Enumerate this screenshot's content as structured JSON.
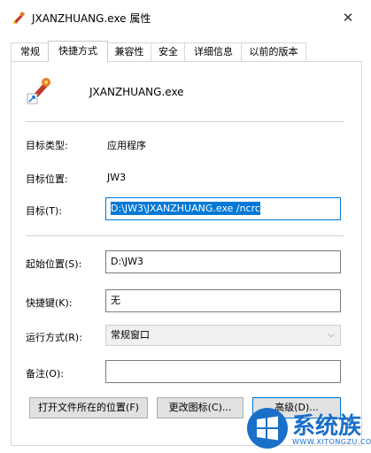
{
  "window": {
    "title": "JXANZHUANG.exe 属性",
    "close_glyph": "✕"
  },
  "tabs": [
    {
      "label": "常规",
      "active": false
    },
    {
      "label": "快捷方式",
      "active": true
    },
    {
      "label": "兼容性",
      "active": false
    },
    {
      "label": "安全",
      "active": false
    },
    {
      "label": "详细信息",
      "active": false
    },
    {
      "label": "以前的版本",
      "active": false
    }
  ],
  "shortcut": {
    "file_name": "JXANZHUANG.exe",
    "target_type_label": "目标类型:",
    "target_type_value": "应用程序",
    "target_location_label": "目标位置:",
    "target_location_value": "JW3",
    "target_label": "目标(T):",
    "target_value": "D:\\JW3\\JXANZHUANG.exe /ncrc",
    "start_in_label": "起始位置(S):",
    "start_in_value": "D:\\JW3",
    "hotkey_label": "快捷键(K):",
    "hotkey_value": "无",
    "run_label": "运行方式(R):",
    "run_value": "常规窗口",
    "comment_label": "备注(O):",
    "comment_value": ""
  },
  "buttons": {
    "open_location": "打开文件所在的位置(F)",
    "change_icon": "更改图标(C)...",
    "advanced": "高级(D)..."
  },
  "watermark": {
    "text": "系统族",
    "url": "WWW.XITONGZU.COM"
  },
  "colors": {
    "accent": "#0078d7",
    "watermark": "#1a6fc9"
  }
}
